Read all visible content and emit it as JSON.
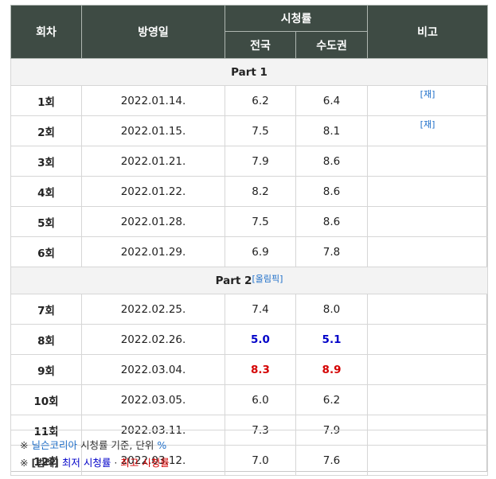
{
  "header": {
    "episode": "회차",
    "air_date": "방영일",
    "ratings": "시청률",
    "nationwide": "전국",
    "capital": "수도권",
    "notes": "비고"
  },
  "parts": {
    "part1": "Part 1",
    "part2": "Part 2",
    "part2_note": "[올림픽]"
  },
  "rerun_note": "[재]",
  "rows_part1": [
    {
      "ep": "1회",
      "date": "2022.01.14.",
      "nat": "6.2",
      "cap": "6.4",
      "note": "[재]"
    },
    {
      "ep": "2회",
      "date": "2022.01.15.",
      "nat": "7.5",
      "cap": "8.1",
      "note": "[재]"
    },
    {
      "ep": "3회",
      "date": "2022.01.21.",
      "nat": "7.9",
      "cap": "8.6",
      "note": ""
    },
    {
      "ep": "4회",
      "date": "2022.01.22.",
      "nat": "8.2",
      "cap": "8.6",
      "note": ""
    },
    {
      "ep": "5회",
      "date": "2022.01.28.",
      "nat": "7.5",
      "cap": "8.6",
      "note": ""
    },
    {
      "ep": "6회",
      "date": "2022.01.29.",
      "nat": "6.9",
      "cap": "7.8",
      "note": ""
    }
  ],
  "rows_part2": [
    {
      "ep": "7회",
      "date": "2022.02.25.",
      "nat": "7.4",
      "cap": "8.0",
      "note": ""
    },
    {
      "ep": "8회",
      "date": "2022.02.26.",
      "nat": "5.0",
      "cap": "5.1",
      "note": "",
      "flag": "low"
    },
    {
      "ep": "9회",
      "date": "2022.03.04.",
      "nat": "8.3",
      "cap": "8.9",
      "note": "",
      "flag": "high"
    },
    {
      "ep": "10회",
      "date": "2022.03.05.",
      "nat": "6.0",
      "cap": "6.2",
      "note": ""
    },
    {
      "ep": "11회",
      "date": "2022.03.11.",
      "nat": "7.3",
      "cap": "7.9",
      "note": ""
    },
    {
      "ep": "12회",
      "date": "2022.03.12.",
      "nat": "7.0",
      "cap": "7.6",
      "note": ""
    }
  ],
  "footer": {
    "mark": "※",
    "source_link": "닐슨코리아",
    "source_rest": " 시청률 기준, 단위 ",
    "unit": "%",
    "legend_label": "[범례]",
    "lowest": "최저 시청률",
    "separator": " · ",
    "highest": "최고 시청률"
  },
  "colors": {
    "header_bg": "#3e4b44",
    "lowest": "#0000c8",
    "highest": "#d40000",
    "link": "#1f6fc9"
  }
}
